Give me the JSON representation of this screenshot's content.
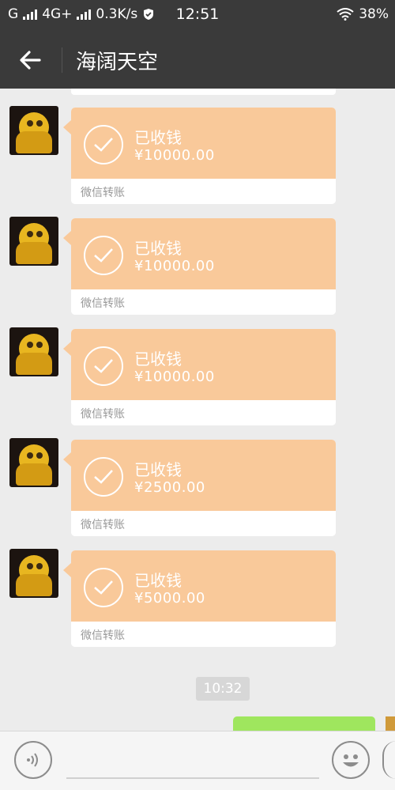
{
  "status_bar": {
    "carrier": "G",
    "network": "4G+",
    "speed": "0.3K/s",
    "time": "12:51",
    "battery": "38%"
  },
  "navbar": {
    "title": "海阔天空",
    "back_icon": "arrow-left-icon"
  },
  "messages": [
    {
      "status": "已收钱",
      "amount": "¥10000.00",
      "source": "微信转账"
    },
    {
      "status": "已收钱",
      "amount": "¥10000.00",
      "source": "微信转账"
    },
    {
      "status": "已收钱",
      "amount": "¥10000.00",
      "source": "微信转账"
    },
    {
      "status": "已收钱",
      "amount": "¥2500.00",
      "source": "微信转账"
    },
    {
      "status": "已收钱",
      "amount": "¥5000.00",
      "source": "微信转账"
    }
  ],
  "timestamp": "10:32",
  "input_bar": {
    "voice_icon": "voice-icon",
    "emoji_icon": "emoji-icon"
  },
  "colors": {
    "header": "#3a3a3a",
    "transfer_card": "#f9c99a",
    "sent_bubble": "#9fe65e",
    "background": "#ececec"
  }
}
